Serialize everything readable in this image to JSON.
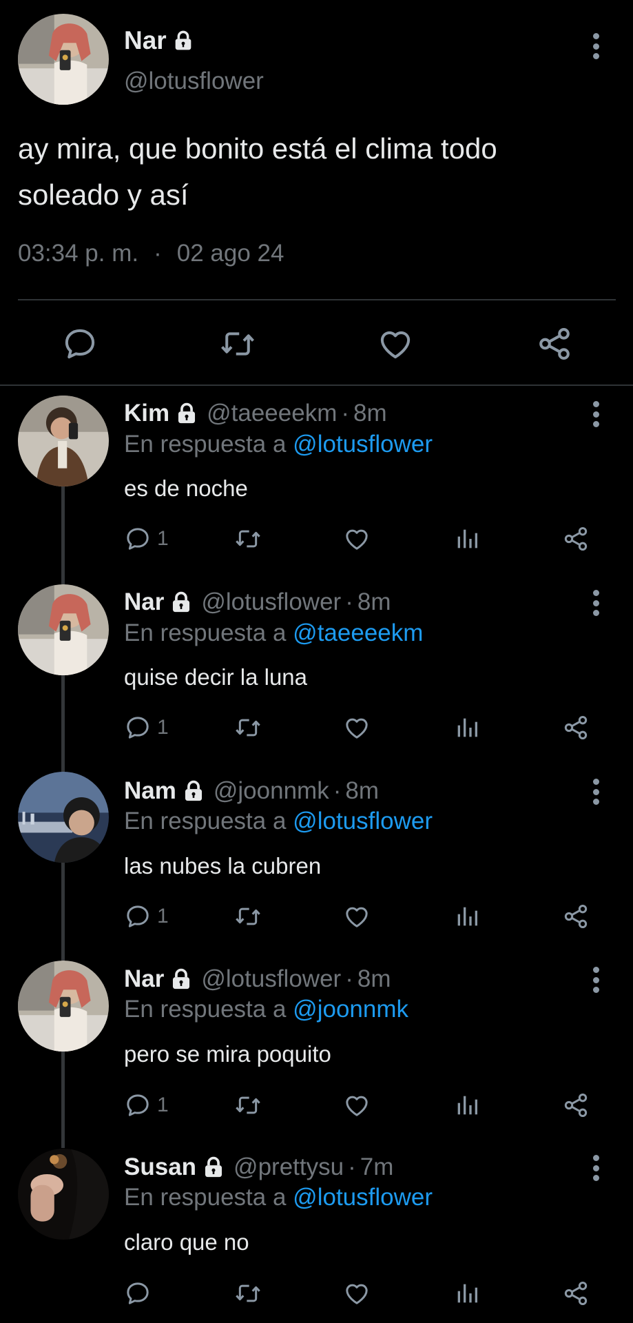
{
  "main_tweet": {
    "name": "Nar",
    "handle": "@lotusflower",
    "text": "ay mira, que bonito está el clima todo soleado y así",
    "time": "03:34 p. m.",
    "separator": "·",
    "date": "02 ago 24"
  },
  "replies": [
    {
      "name": "Kim",
      "handle": "@taeeeekm",
      "age": "8m",
      "reply_label": "En respuesta a",
      "reply_to": "@lotusflower",
      "text": "es de noche",
      "reply_count": "1"
    },
    {
      "name": "Nar",
      "handle": "@lotusflower",
      "age": "8m",
      "reply_label": "En respuesta a",
      "reply_to": "@taeeeekm",
      "text": "quise decir la luna",
      "reply_count": "1"
    },
    {
      "name": "Nam",
      "handle": "@joonnmk",
      "age": "8m",
      "reply_label": "En respuesta a",
      "reply_to": "@lotusflower",
      "text": "las nubes la cubren",
      "reply_count": "1"
    },
    {
      "name": "Nar",
      "handle": "@lotusflower",
      "age": "8m",
      "reply_label": "En respuesta a",
      "reply_to": "@joonnmk",
      "text": "pero se mira poquito",
      "reply_count": "1"
    },
    {
      "name": "Susan",
      "handle": "@prettysu",
      "age": "7m",
      "reply_label": "En respuesta a",
      "reply_to": "@lotusflower",
      "text": "claro que no",
      "reply_count": ""
    }
  ],
  "icons": {
    "lock": "lock-icon",
    "more": "more-vertical-icon",
    "reply": "comment-icon",
    "retweet": "retweet-icon",
    "like": "heart-icon",
    "views": "views-icon",
    "share": "share-icon"
  },
  "colors": {
    "background": "#000000",
    "text": "#e7e9ea",
    "muted": "#71767b",
    "link": "#1d9bf0",
    "divider": "#2f3336"
  }
}
